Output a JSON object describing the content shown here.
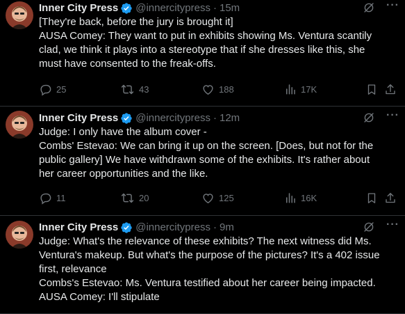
{
  "colors": {
    "background": "#000000",
    "text_primary": "#e7e9ea",
    "text_secondary": "#71767b",
    "verified_badge": "#1d9bf0",
    "divider": "#2f3336"
  },
  "icons": {
    "verified": "verified-badge-icon",
    "grok": "grok-icon",
    "more": "more-icon",
    "reply": "reply-icon",
    "retweet": "retweet-icon",
    "like": "heart-icon",
    "views": "views-icon",
    "bookmark": "bookmark-icon",
    "share": "share-icon"
  },
  "tweets": [
    {
      "author": "Inner City Press",
      "handle": "@innercitypress",
      "time": "15m",
      "lines": [
        "[They're back, before the jury is brought it]",
        "AUSA Comey: They want to put in exhibits showing Ms. Ventura scantily",
        "clad, we think it plays into a stereotype that if she dresses like this, she",
        "must have consented to the freak-offs."
      ],
      "replies": "25",
      "retweets": "43",
      "likes": "188",
      "views": "17K"
    },
    {
      "author": "Inner City Press",
      "handle": "@innercitypress",
      "time": "12m",
      "lines": [
        "Judge: I only have the album cover -",
        "Combs' Estevao: We can bring it up on the screen. [Does, but not for the",
        "public gallery] We have withdrawn some of the exhibits. It's rather about",
        "her career opportunities and the like."
      ],
      "replies": "11",
      "retweets": "20",
      "likes": "125",
      "views": "16K"
    },
    {
      "author": "Inner City Press",
      "handle": "@innercitypress",
      "time": "9m",
      "lines": [
        "Judge: What's the relevance of these exhibits? The next witness did Ms.",
        "Ventura's makeup. But what's the purpose of the pictures? It's a 402 issue",
        "first, relevance",
        "Combs's Estevao: Ms. Ventura testified about her career being impacted.",
        "AUSA Comey: I'll stipulate"
      ]
    }
  ]
}
